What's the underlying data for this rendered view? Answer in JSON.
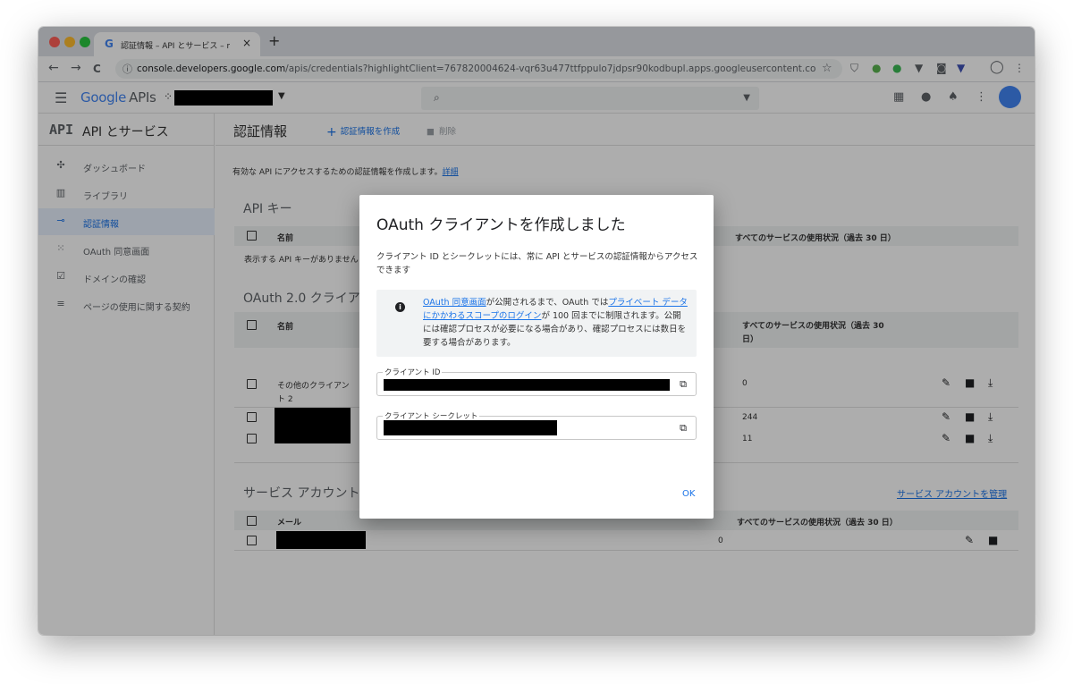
{
  "browser": {
    "tab_title": "認証情報 – API とサービス – my-h",
    "tab_favicon": "G",
    "tab_close": "×",
    "new_tab": "+",
    "url_host": "console.developers.google.com",
    "url_path": "/apis/credentials?highlightClient=767820004624-vqr63u477ttfppulo7jdpsr90kodbupl.apps.googleusercontent.com&clien...",
    "back_icon": "←",
    "forward_icon": "→",
    "reload_icon": "C",
    "info_icon": "ⓘ",
    "star_icon": "☆"
  },
  "app_header": {
    "logo_google": "Google",
    "logo_apis": "APIs",
    "project_dots": "⁘",
    "search_icon": "🔍"
  },
  "sidebar": {
    "api_logo": "API",
    "title": "API とサービス",
    "items": [
      {
        "label": "ダッシュボード",
        "icon": "dashboard-icon",
        "glyph": "✣"
      },
      {
        "label": "ライブラリ",
        "icon": "library-icon",
        "glyph": "▥"
      },
      {
        "label": "認証情報",
        "icon": "key-icon",
        "glyph": "⊸"
      },
      {
        "label": "OAuth 同意画面",
        "icon": "consent-icon",
        "glyph": "⁙"
      },
      {
        "label": "ドメインの確認",
        "icon": "domain-icon",
        "glyph": "☑"
      },
      {
        "label": "ページの使用に関する契約",
        "icon": "settings-list-icon",
        "glyph": "≡"
      }
    ],
    "active_index": 2,
    "collapse_label": "<I"
  },
  "main": {
    "title": "認証情報",
    "create_label": "認証情報を作成",
    "delete_label": "削除",
    "intro_text": "有効な API にアクセスするための認証情報を作成します。",
    "intro_link": "詳細",
    "api_keys": {
      "title": "API キー",
      "col_name": "名前",
      "col_usage": "すべてのサービスの使用状況（過去 30 日）",
      "empty_text": "表示する API キーがありません"
    },
    "oauth": {
      "title": "OAuth 2.0 クライアント ID",
      "col_name": "名前",
      "col_usage_line1": "すべてのサービスの使用状況（過去 30",
      "col_usage_line2": "日）",
      "rows": [
        {
          "name_line1": "その他のクライアン",
          "name_line2": "ト 2",
          "usage": "0"
        },
        {
          "name_line1": "",
          "name_line2": "",
          "usage": "244"
        },
        {
          "name_line1": "",
          "name_line2": "",
          "usage": "11"
        }
      ]
    },
    "service_accounts": {
      "title": "サービス アカウント",
      "manage_link": "サービス アカウントを管理",
      "col_email": "メール",
      "col_usage": "すべてのサービスの使用状況（過去 30 日）",
      "rows": [
        {
          "usage": "0"
        }
      ]
    }
  },
  "dialog": {
    "title": "OAuth クライアントを作成しました",
    "description": "クライアント ID とシークレットには、常に API とサービスの認証情報からアクセスできます",
    "note_link1": "OAuth 同意画面",
    "note_text1": "が公開されるまで、OAuth では",
    "note_link2": "プライベート データにかかわるスコープのログイン",
    "note_text2": "が 100 回までに制限されます。公開には確認プロセスが必要になる場合があり、確認プロセスには数日を要する場合があります。",
    "client_id_label": "クライアント ID",
    "client_secret_label": "クライアント シークレット",
    "ok_label": "OK"
  },
  "colors": {
    "accent": "#1a73e8",
    "active_bg": "#e8f0fe"
  }
}
